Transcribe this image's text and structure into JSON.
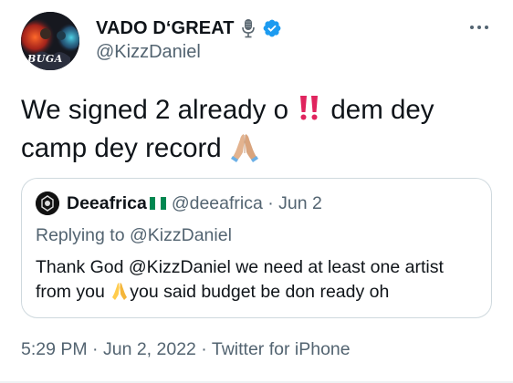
{
  "author": {
    "display_name": "VADO D‘GREAT",
    "handle": "@KizzDaniel",
    "avatar_text": "BUGA",
    "icons": [
      "microphone-icon",
      "verified-badge-icon"
    ],
    "verified_color": "#1d9bf0"
  },
  "menu": {
    "icon": "more-options-icon"
  },
  "tweet": {
    "line1_before": "We signed 2 already o ",
    "line1_after": " dem dey",
    "line2": "camp dey record ",
    "emojis": [
      "double-exclamation-icon",
      "folded-hands-icon"
    ]
  },
  "quote": {
    "display_name": "Deeafrica",
    "handle": "@deeafrica",
    "date": "Jun 2",
    "replying_prefix": "Replying to ",
    "replying_to": "@KizzDaniel",
    "line1": "Thank God @KizzDaniel  we need at least one artist",
    "line2_before": "from you ",
    "line2_after": "you said budget be don ready oh",
    "flag_icon": "nigeria-flag-icon"
  },
  "footer": {
    "time": "5:29 PM",
    "date": "Jun 2, 2022",
    "source": "Twitter for iPhone"
  }
}
